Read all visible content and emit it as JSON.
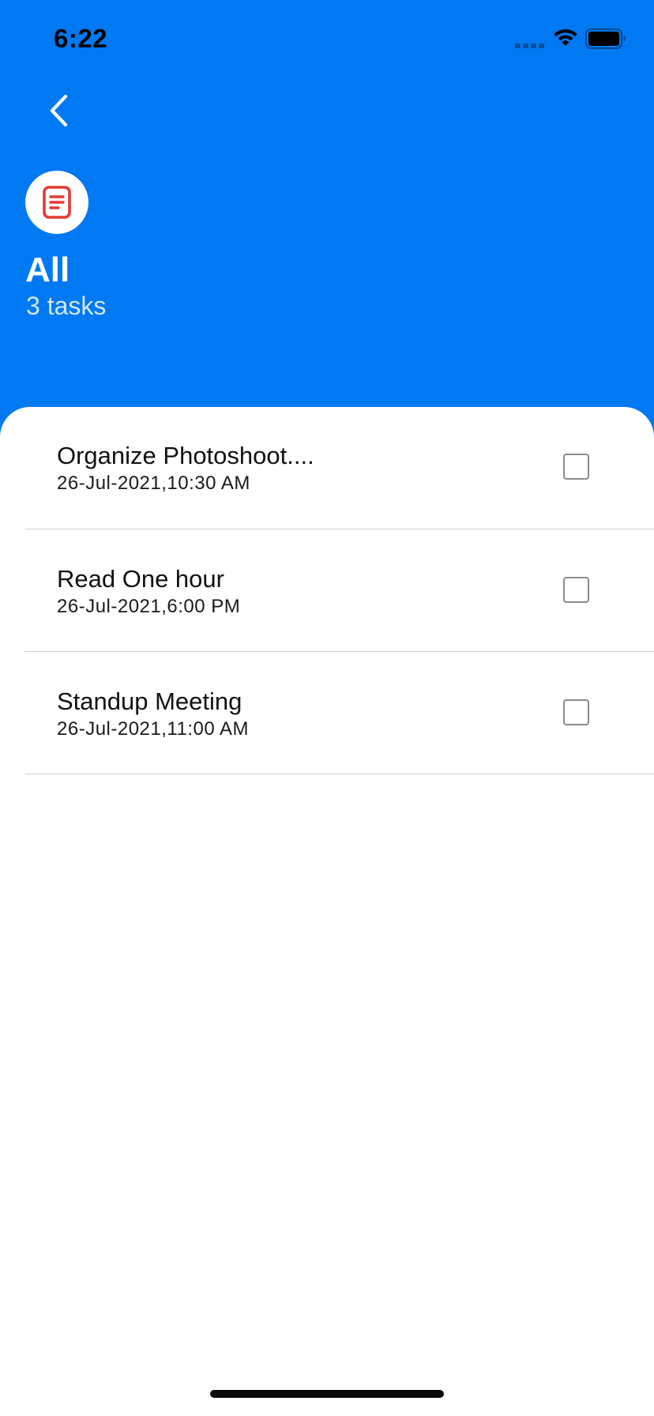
{
  "status_bar": {
    "time": "6:22"
  },
  "icons": {
    "back": "chevron-left-icon",
    "list": "document-list-icon",
    "signal": "signal-icon",
    "wifi": "wifi-icon",
    "battery": "battery-icon"
  },
  "header": {
    "title": "All",
    "count": "3 tasks"
  },
  "tasks": [
    {
      "title": "Organize Photoshoot....",
      "date": "26-Jul-2021,10:30 AM",
      "completed": false
    },
    {
      "title": "Read One hour",
      "date": "26-Jul-2021,6:00 PM",
      "completed": false
    },
    {
      "title": "Standup Meeting",
      "date": "26-Jul-2021,11:00 AM",
      "completed": false
    }
  ],
  "colors": {
    "header_background": "#0079F2",
    "sheet_background": "#FFFFFF",
    "list_icon": "#E53935"
  }
}
